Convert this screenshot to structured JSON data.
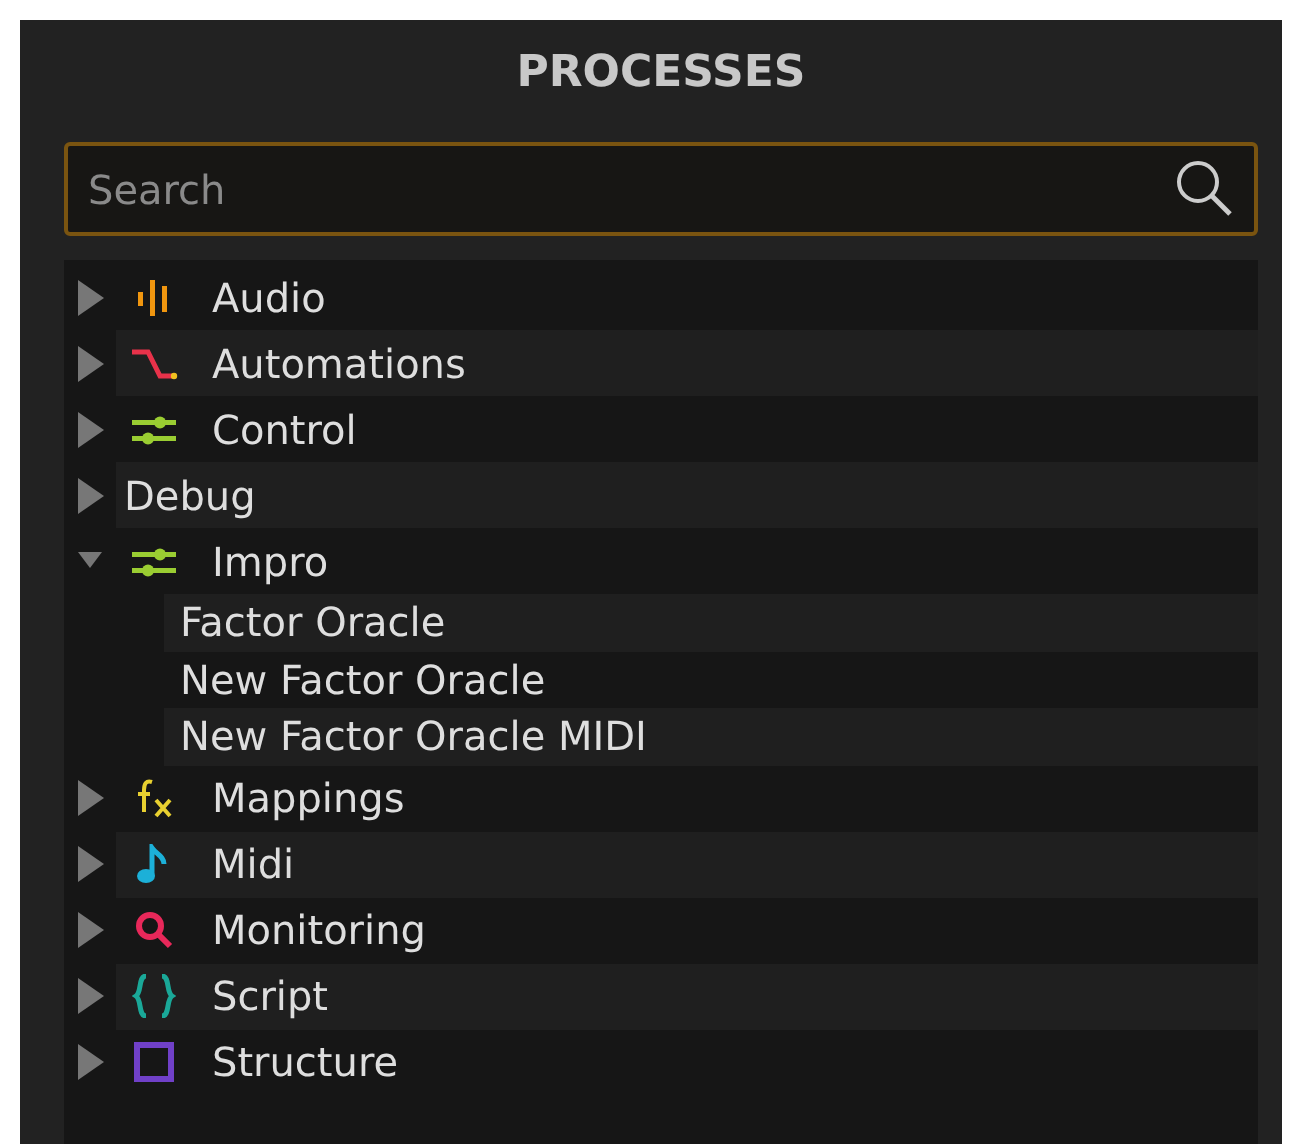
{
  "panel": {
    "title": "PROCESSES"
  },
  "search": {
    "placeholder": "Search"
  },
  "tree": [
    {
      "label": "Audio",
      "kind": "audio",
      "expanded": false
    },
    {
      "label": "Automations",
      "kind": "automation",
      "expanded": false
    },
    {
      "label": "Control",
      "kind": "control",
      "expanded": false
    },
    {
      "label": "Debug",
      "kind": "plain",
      "expanded": false
    },
    {
      "label": "Impro",
      "kind": "control",
      "expanded": true,
      "children": [
        {
          "label": "Factor Oracle"
        },
        {
          "label": "New Factor Oracle"
        },
        {
          "label": "New Factor Oracle MIDI"
        }
      ]
    },
    {
      "label": "Mappings",
      "kind": "mapping",
      "expanded": false
    },
    {
      "label": "Midi",
      "kind": "midi",
      "expanded": false
    },
    {
      "label": "Monitoring",
      "kind": "monitoring",
      "expanded": false
    },
    {
      "label": "Script",
      "kind": "script",
      "expanded": false
    },
    {
      "label": "Structure",
      "kind": "structure",
      "expanded": false
    }
  ]
}
